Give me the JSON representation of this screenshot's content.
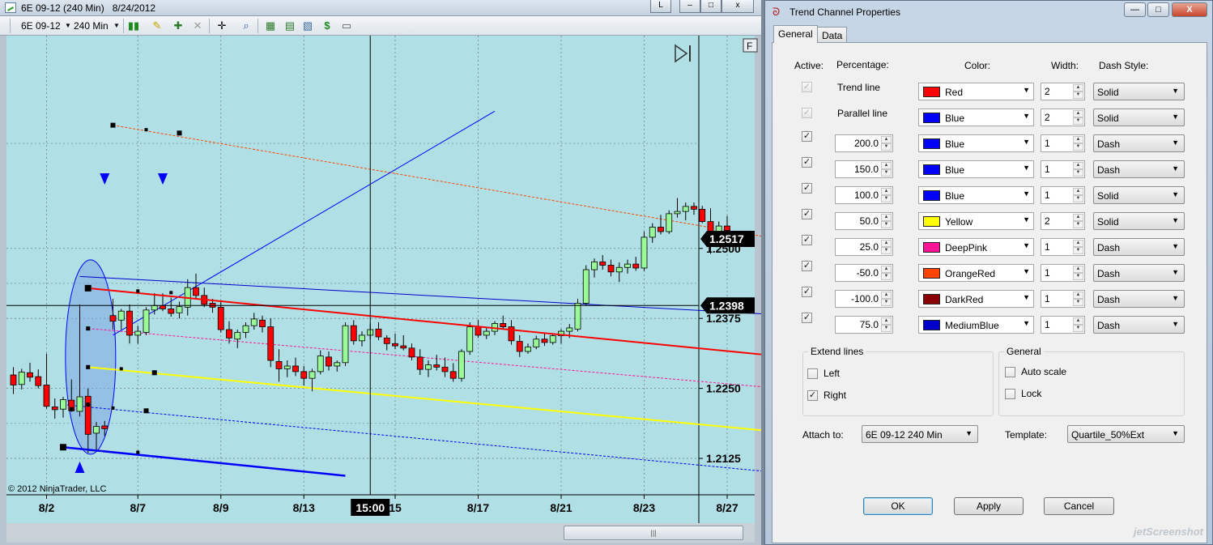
{
  "chart_window": {
    "title": "6E 09-12 (240 Min)   8/24/2012",
    "buttons": {
      "restore": "L",
      "minimize": "–",
      "maximize": "□",
      "close": "x"
    },
    "toolbar": {
      "instrument": "6E 09-12",
      "interval": "240 Min"
    },
    "f_label": "F",
    "copyright": "© 2012 NinjaTrader, LLC",
    "scroll_grip": "|||"
  },
  "chart_data": {
    "type": "candlestick",
    "instrument": "6E 09-12",
    "interval": "240 Min",
    "ylim": [
      1.206,
      1.288
    ],
    "y_ticks": [
      "1.2500",
      "1.2375",
      "1.2250",
      "1.2125"
    ],
    "y_tick_values": [
      1.25,
      1.2375,
      1.225,
      1.2125
    ],
    "price_markers": [
      {
        "label": "1.2517",
        "value": 1.2517
      },
      {
        "label": "1.2398",
        "value": 1.2398
      }
    ],
    "x_ticks": [
      "8/2",
      "8/7",
      "8/9",
      "8/13",
      "15",
      "8/17",
      "8/21",
      "8/23",
      "8/27"
    ],
    "x_tick_index": [
      4,
      15,
      25,
      35,
      46,
      56,
      66,
      76,
      86
    ],
    "crosshair": {
      "time_label": "15:00",
      "index": 43,
      "price": 1.2398
    },
    "grid": true,
    "candles": [
      [
        1.2274,
        1.2288,
        1.224,
        1.2256
      ],
      [
        1.2257,
        1.2285,
        1.2248,
        1.2279
      ],
      [
        1.2278,
        1.2296,
        1.2262,
        1.227
      ],
      [
        1.2271,
        1.2284,
        1.225,
        1.2255
      ],
      [
        1.2256,
        1.2312,
        1.2214,
        1.2218
      ],
      [
        1.2217,
        1.2232,
        1.2196,
        1.2212
      ],
      [
        1.2213,
        1.2235,
        1.2198,
        1.223
      ],
      [
        1.2229,
        1.2266,
        1.2208,
        1.221
      ],
      [
        1.2209,
        1.24,
        1.22,
        1.2235
      ],
      [
        1.2236,
        1.225,
        1.2135,
        1.2168
      ],
      [
        1.217,
        1.219,
        1.214,
        1.2182
      ],
      [
        1.2183,
        1.2192,
        1.2165,
        1.2178
      ],
      [
        1.238,
        1.241,
        1.2355,
        1.237
      ],
      [
        1.2372,
        1.2392,
        1.2355,
        1.2388
      ],
      [
        1.2388,
        1.24,
        1.233,
        1.2345
      ],
      [
        1.2345,
        1.2362,
        1.233,
        1.2352
      ],
      [
        1.235,
        1.2395,
        1.2345,
        1.239
      ],
      [
        1.239,
        1.242,
        1.2382,
        1.2398
      ],
      [
        1.2398,
        1.242,
        1.2388,
        1.2392
      ],
      [
        1.2392,
        1.2412,
        1.2378,
        1.2384
      ],
      [
        1.2385,
        1.2405,
        1.2375,
        1.2396
      ],
      [
        1.2395,
        1.2445,
        1.238,
        1.243
      ],
      [
        1.243,
        1.2455,
        1.241,
        1.2416
      ],
      [
        1.2416,
        1.243,
        1.2395,
        1.24
      ],
      [
        1.2402,
        1.241,
        1.2385,
        1.2395
      ],
      [
        1.2395,
        1.2405,
        1.235,
        1.2355
      ],
      [
        1.2355,
        1.237,
        1.233,
        1.234
      ],
      [
        1.2338,
        1.2355,
        1.2322,
        1.235
      ],
      [
        1.235,
        1.2368,
        1.234,
        1.2362
      ],
      [
        1.2362,
        1.2385,
        1.2355,
        1.2374
      ],
      [
        1.2372,
        1.238,
        1.235,
        1.236
      ],
      [
        1.236,
        1.2375,
        1.2288,
        1.23
      ],
      [
        1.2298,
        1.232,
        1.2262,
        1.2285
      ],
      [
        1.2285,
        1.23,
        1.227,
        1.229
      ],
      [
        1.229,
        1.2305,
        1.2272,
        1.228
      ],
      [
        1.228,
        1.229,
        1.2255,
        1.2268
      ],
      [
        1.2268,
        1.2285,
        1.2245,
        1.228
      ],
      [
        1.228,
        1.2318,
        1.2275,
        1.2308
      ],
      [
        1.2306,
        1.2316,
        1.2282,
        1.229
      ],
      [
        1.229,
        1.23,
        1.228,
        1.2296
      ],
      [
        1.2296,
        1.2368,
        1.229,
        1.2362
      ],
      [
        1.2362,
        1.2372,
        1.2328,
        1.2335
      ],
      [
        1.2335,
        1.2352,
        1.2325,
        1.2345
      ],
      [
        1.2345,
        1.2366,
        1.2338,
        1.2355
      ],
      [
        1.2356,
        1.2368,
        1.2336,
        1.2342
      ],
      [
        1.234,
        1.2345,
        1.2318,
        1.233
      ],
      [
        1.233,
        1.2348,
        1.232,
        1.2326
      ],
      [
        1.2326,
        1.2345,
        1.2318,
        1.2322
      ],
      [
        1.2322,
        1.233,
        1.23,
        1.2306
      ],
      [
        1.2306,
        1.232,
        1.2274,
        1.2284
      ],
      [
        1.2284,
        1.23,
        1.227,
        1.2292
      ],
      [
        1.2292,
        1.231,
        1.2282,
        1.2288
      ],
      [
        1.2288,
        1.2305,
        1.227,
        1.228
      ],
      [
        1.228,
        1.2295,
        1.2262,
        1.2268
      ],
      [
        1.2268,
        1.232,
        1.2262,
        1.2316
      ],
      [
        1.2316,
        1.2368,
        1.231,
        1.236
      ],
      [
        1.236,
        1.2372,
        1.234,
        1.2345
      ],
      [
        1.2345,
        1.236,
        1.2338,
        1.2352
      ],
      [
        1.2352,
        1.237,
        1.2345,
        1.2366
      ],
      [
        1.2366,
        1.238,
        1.2355,
        1.236
      ],
      [
        1.236,
        1.2372,
        1.2328,
        1.2335
      ],
      [
        1.2334,
        1.2345,
        1.2306,
        1.2316
      ],
      [
        1.2316,
        1.233,
        1.2312,
        1.2324
      ],
      [
        1.2324,
        1.2344,
        1.232,
        1.2338
      ],
      [
        1.2338,
        1.235,
        1.2326,
        1.2332
      ],
      [
        1.2332,
        1.2348,
        1.2328,
        1.2344
      ],
      [
        1.2344,
        1.2356,
        1.233,
        1.2352
      ],
      [
        1.2352,
        1.2365,
        1.234,
        1.2358
      ],
      [
        1.2356,
        1.241,
        1.2352,
        1.2402
      ],
      [
        1.2402,
        1.247,
        1.2398,
        1.2462
      ],
      [
        1.2462,
        1.2482,
        1.2448,
        1.2476
      ],
      [
        1.2476,
        1.2488,
        1.2462,
        1.247
      ],
      [
        1.247,
        1.248,
        1.245,
        1.2458
      ],
      [
        1.2458,
        1.2475,
        1.244,
        1.2466
      ],
      [
        1.2466,
        1.248,
        1.2455,
        1.2472
      ],
      [
        1.2472,
        1.2485,
        1.246,
        1.2465
      ],
      [
        1.2465,
        1.253,
        1.246,
        1.252
      ],
      [
        1.252,
        1.2545,
        1.251,
        1.2538
      ],
      [
        1.2538,
        1.256,
        1.2525,
        1.253
      ],
      [
        1.253,
        1.2568,
        1.2526,
        1.2562
      ],
      [
        1.2562,
        1.259,
        1.2555,
        1.2566
      ],
      [
        1.2566,
        1.2582,
        1.255,
        1.2575
      ],
      [
        1.2575,
        1.2582,
        1.256,
        1.257
      ],
      [
        1.257,
        1.2576,
        1.2545,
        1.2548
      ],
      [
        1.2548,
        1.2572,
        1.249,
        1.2512
      ],
      [
        1.2512,
        1.2548,
        1.2508,
        1.254
      ],
      [
        1.254,
        1.2558,
        1.2528,
        1.2532
      ]
    ],
    "drawings": {
      "trend_line": {
        "color": "#ff0000",
        "from": [
          9,
          1.2429
        ],
        "to": [
          94,
          1.2305
        ]
      },
      "parallel_line": {
        "color": "#0000ff",
        "from": [
          6,
          1.2145
        ],
        "to": [
          40,
          1.2094
        ]
      },
      "levels": [
        {
          "pct": "200.0",
          "color": "#0000ff",
          "from": [
            6,
            1.2221
          ],
          "to": [
            94,
            1.2097
          ],
          "dash": true
        },
        {
          "pct": "75.0",
          "color": "#0000cd",
          "from": [
            8,
            1.245
          ],
          "to": [
            94,
            1.238
          ],
          "dash": false
        },
        {
          "pct": "50.0",
          "color": "#ffff00",
          "from": [
            9,
            1.2288
          ],
          "to": [
            94,
            1.217
          ],
          "dash": false
        },
        {
          "pct": "25.0",
          "color": "#ff1493",
          "from": [
            9,
            1.2357
          ],
          "to": [
            94,
            1.2248
          ],
          "dash": true
        },
        {
          "pct": "-50.0",
          "color": "#ff4500",
          "from": [
            12,
            1.272
          ],
          "to": [
            94,
            1.2512
          ],
          "dash": true
        }
      ],
      "ray": {
        "color": "#0000ff",
        "from": [
          12,
          1.2345
        ],
        "to": [
          58,
          1.2745
        ]
      },
      "ellipse": {
        "center_index": 9.3,
        "center_price": 1.2306,
        "fill": "#7da6e0"
      },
      "arrows_down": [
        11,
        18
      ],
      "arrow_up": [
        8
      ]
    }
  },
  "dialog": {
    "title": "Trend Channel Properties",
    "window_buttons": {
      "minimize": "—",
      "maximize": "□",
      "close": "X"
    },
    "tabs": [
      {
        "label": "General",
        "active": true
      },
      {
        "label": "Data",
        "active": false
      }
    ],
    "headers": {
      "active": "Active:",
      "percentage": "Percentage:",
      "color": "Color:",
      "width": "Width:",
      "dash_style": "Dash Style:"
    },
    "rows": [
      {
        "active": true,
        "enabled": false,
        "label": "Trend line",
        "color_name": "Red",
        "swatch": "#ff0000",
        "width": "2",
        "dash": "Solid"
      },
      {
        "active": true,
        "enabled": false,
        "label": "Parallel line",
        "color_name": "Blue",
        "swatch": "#0000ff",
        "width": "2",
        "dash": "Solid"
      },
      {
        "active": true,
        "enabled": true,
        "pct": "200.0",
        "color_name": "Blue",
        "swatch": "#0000ff",
        "width": "1",
        "dash": "Dash"
      },
      {
        "active": true,
        "enabled": true,
        "pct": "150.0",
        "color_name": "Blue",
        "swatch": "#0000ff",
        "width": "1",
        "dash": "Dash"
      },
      {
        "active": true,
        "enabled": true,
        "pct": "100.0",
        "color_name": "Blue",
        "swatch": "#0000ff",
        "width": "1",
        "dash": "Solid"
      },
      {
        "active": true,
        "enabled": true,
        "pct": "50.0",
        "color_name": "Yellow",
        "swatch": "#ffff00",
        "width": "2",
        "dash": "Solid"
      },
      {
        "active": true,
        "enabled": true,
        "pct": "25.0",
        "color_name": "DeepPink",
        "swatch": "#ff1493",
        "width": "1",
        "dash": "Dash"
      },
      {
        "active": true,
        "enabled": true,
        "pct": "-50.0",
        "color_name": "OrangeRed",
        "swatch": "#ff4500",
        "width": "1",
        "dash": "Dash"
      },
      {
        "active": true,
        "enabled": true,
        "pct": "-100.0",
        "color_name": "DarkRed",
        "swatch": "#8b0000",
        "width": "1",
        "dash": "Dash"
      },
      {
        "active": true,
        "enabled": true,
        "pct": "75.0",
        "color_name": "MediumBlue",
        "swatch": "#0000cd",
        "width": "1",
        "dash": "Dash"
      }
    ],
    "extend_lines": {
      "title": "Extend lines",
      "left_label": "Left",
      "left": false,
      "right_label": "Right",
      "right": true
    },
    "general": {
      "title": "General",
      "auto_scale_label": "Auto scale",
      "auto_scale": false,
      "lock_label": "Lock",
      "lock": false
    },
    "attach_to": {
      "label": "Attach to:",
      "value": "6E 09-12 240 Min"
    },
    "template": {
      "label": "Template:",
      "value": "Quartile_50%Ext"
    },
    "buttons": {
      "ok": "OK",
      "apply": "Apply",
      "cancel": "Cancel"
    },
    "watermark": "jetScreenshot"
  }
}
